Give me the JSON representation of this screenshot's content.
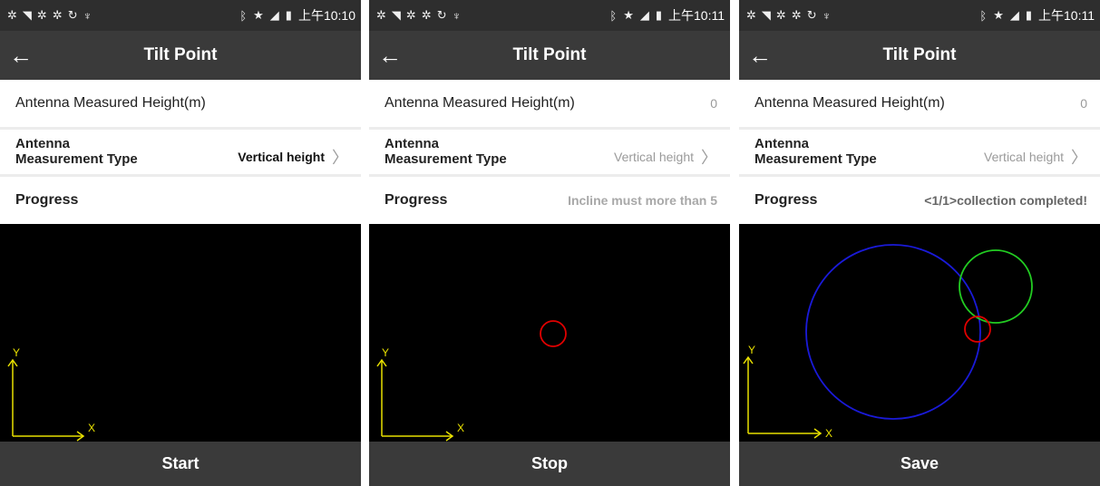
{
  "screens": [
    {
      "status": {
        "icons": [
          "settings-icon",
          "wifi-icon",
          "settings-icon",
          "settings-icon",
          "sync-icon",
          "usb-icon"
        ],
        "right_icons": [
          "bluetooth-icon",
          "star-icon",
          "no-signal-icon",
          "battery-icon"
        ],
        "time": "上午10:10"
      },
      "app_title": "Tilt Point",
      "antenna_height_label": "Antenna Measured Height(m)",
      "antenna_height_value": "",
      "measurement_label": "Antenna Measurement Type",
      "measurement_value": "Vertical height",
      "progress_label": "Progress",
      "progress_value": "",
      "axis_y": "Y",
      "axis_x": "X",
      "button_label": "Start"
    },
    {
      "status": {
        "icons": [
          "settings-icon",
          "wifi-icon",
          "settings-icon",
          "settings-icon",
          "sync-icon",
          "usb-icon"
        ],
        "right_icons": [
          "bluetooth-icon",
          "star-icon",
          "no-signal-icon",
          "battery-icon"
        ],
        "time": "上午10:11"
      },
      "app_title": "Tilt Point",
      "antenna_height_label": "Antenna Measured Height(m)",
      "antenna_height_value": "0",
      "measurement_label": "Antenna Measurement Type",
      "measurement_value": "Vertical height",
      "progress_label": "Progress",
      "progress_value": "Incline must more than 5",
      "axis_y": "Y",
      "axis_x": "X",
      "button_label": "Stop"
    },
    {
      "status": {
        "icons": [
          "settings-icon",
          "wifi-icon",
          "settings-icon",
          "settings-icon",
          "sync-icon",
          "usb-icon"
        ],
        "right_icons": [
          "bluetooth-icon",
          "star-icon",
          "no-signal-icon",
          "battery-icon"
        ],
        "time": "上午10:11"
      },
      "app_title": "Tilt Point",
      "antenna_height_label": "Antenna Measured Height(m)",
      "antenna_height_value": "0",
      "measurement_label": "Antenna Measurement Type",
      "measurement_value": "Vertical height",
      "progress_label": "Progress",
      "progress_value": "<1/1>collection completed!",
      "axis_y": "Y",
      "axis_x": "X",
      "button_label": "Save"
    }
  ],
  "colors": {
    "axis": "#e8e000",
    "red_circle": "#e00000",
    "blue_circle": "#1a1ad8",
    "green_circle": "#22cc22"
  }
}
